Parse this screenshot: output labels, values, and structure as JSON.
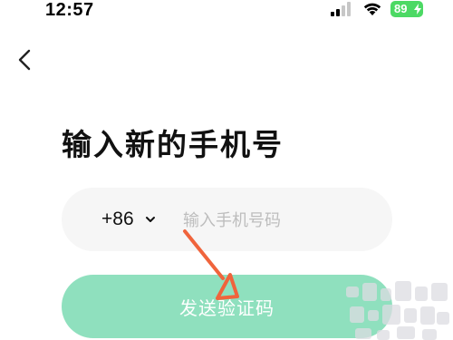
{
  "status_bar": {
    "time": "12:57",
    "battery": "89",
    "icons": [
      "signal-icon",
      "wifi-icon",
      "battery-icon"
    ]
  },
  "nav": {
    "back_icon": "chevron-left-icon"
  },
  "page": {
    "title": "输入新的手机号"
  },
  "phone_form": {
    "country_code": "+86",
    "country_code_icon": "chevron-down-icon",
    "input_value": "",
    "input_placeholder": "输入手机号码",
    "send_code_label": "发送验证码"
  },
  "colors": {
    "primary_disabled": "#8fe0be",
    "input_background": "#f6f6f6",
    "placeholder": "#bdbdbd",
    "battery": "#4cd964",
    "annotation": "#f0643c"
  }
}
